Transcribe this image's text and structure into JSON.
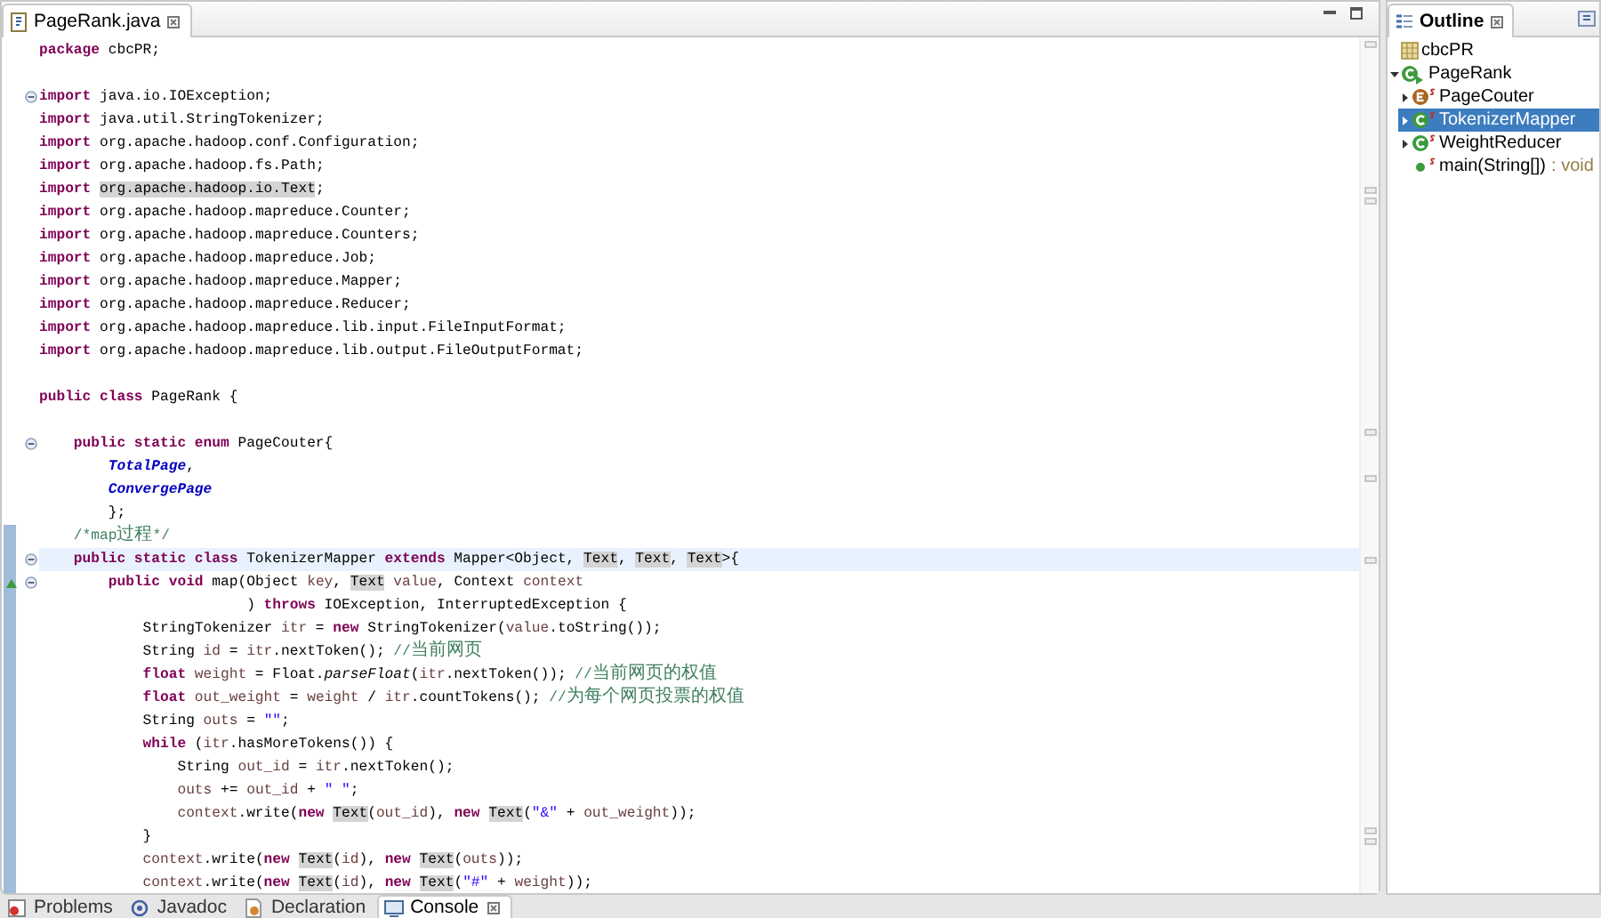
{
  "editor": {
    "tab": {
      "label": "PageRank.java"
    },
    "lines": [
      {
        "current": false,
        "fold": false,
        "range": false,
        "override": false,
        "tokens": [
          {
            "kind": "kw",
            "text": "package"
          },
          {
            "kind": "plain",
            "text": " cbcPR;"
          }
        ]
      },
      {
        "current": false,
        "fold": false,
        "range": false,
        "override": false
      },
      {
        "current": false,
        "fold": true,
        "range": false,
        "override": false,
        "tokens": [
          {
            "kind": "kw",
            "text": "import"
          },
          {
            "kind": "plain",
            "text": " java.io.IOException;"
          }
        ]
      },
      {
        "current": false,
        "fold": false,
        "range": false,
        "override": false,
        "tokens": [
          {
            "kind": "kw",
            "text": "import"
          },
          {
            "kind": "plain",
            "text": " java.util.StringTokenizer;"
          }
        ]
      },
      {
        "current": false,
        "fold": false,
        "range": false,
        "override": false,
        "tokens": [
          {
            "kind": "kw",
            "text": "import"
          },
          {
            "kind": "plain",
            "text": " org.apache.hadoop.conf.Configuration;"
          }
        ]
      },
      {
        "current": false,
        "fold": false,
        "range": false,
        "override": false,
        "tokens": [
          {
            "kind": "kw",
            "text": "import"
          },
          {
            "kind": "plain",
            "text": " org.apache.hadoop.fs.Path;"
          }
        ]
      },
      {
        "current": false,
        "fold": false,
        "range": false,
        "override": false,
        "tokens": [
          {
            "kind": "kw",
            "text": "import "
          },
          {
            "kind": "mark",
            "text": "org.apache.hadoop.io.Text"
          },
          {
            "kind": "plain",
            "text": ";"
          }
        ]
      },
      {
        "current": false,
        "fold": false,
        "range": false,
        "override": false,
        "tokens": [
          {
            "kind": "kw",
            "text": "import"
          },
          {
            "kind": "plain",
            "text": " org.apache.hadoop.mapreduce.Counter;"
          }
        ]
      },
      {
        "current": false,
        "fold": false,
        "range": false,
        "override": false,
        "tokens": [
          {
            "kind": "kw",
            "text": "import"
          },
          {
            "kind": "plain",
            "text": " org.apache.hadoop.mapreduce.Counters;"
          }
        ]
      },
      {
        "current": false,
        "fold": false,
        "range": false,
        "override": false,
        "tokens": [
          {
            "kind": "kw",
            "text": "import"
          },
          {
            "kind": "plain",
            "text": " org.apache.hadoop.mapreduce.Job;"
          }
        ]
      },
      {
        "current": false,
        "fold": false,
        "range": false,
        "override": false,
        "tokens": [
          {
            "kind": "kw",
            "text": "import"
          },
          {
            "kind": "plain",
            "text": " org.apache.hadoop.mapreduce.Mapper;"
          }
        ]
      },
      {
        "current": false,
        "fold": false,
        "range": false,
        "override": false,
        "tokens": [
          {
            "kind": "kw",
            "text": "import"
          },
          {
            "kind": "plain",
            "text": " org.apache.hadoop.mapreduce.Reducer;"
          }
        ]
      },
      {
        "current": false,
        "fold": false,
        "range": false,
        "override": false,
        "tokens": [
          {
            "kind": "kw",
            "text": "import"
          },
          {
            "kind": "plain",
            "text": " org.apache.hadoop.mapreduce.lib.input.FileInputFormat;"
          }
        ]
      },
      {
        "current": false,
        "fold": false,
        "range": false,
        "override": false,
        "tokens": [
          {
            "kind": "kw",
            "text": "import"
          },
          {
            "kind": "plain",
            "text": " org.apache.hadoop.mapreduce.lib.output.FileOutputFormat;"
          }
        ]
      },
      {
        "current": false,
        "fold": false,
        "range": false,
        "override": false
      },
      {
        "current": false,
        "fold": false,
        "range": false,
        "override": false,
        "tokens": [
          {
            "kind": "kw",
            "text": "public class"
          },
          {
            "kind": "plain",
            "text": " PageRank {"
          }
        ]
      },
      {
        "current": false,
        "fold": false,
        "range": false,
        "override": false
      },
      {
        "current": false,
        "fold": true,
        "range": false,
        "override": false,
        "tokens": [
          {
            "kind": "kw",
            "text": "    public static enum"
          },
          {
            "kind": "plain",
            "text": " PageCouter{"
          }
        ]
      },
      {
        "current": false,
        "fold": false,
        "range": false,
        "override": false,
        "tokens": [
          {
            "kind": "const",
            "text": "        TotalPage"
          },
          {
            "kind": "plain",
            "text": ","
          }
        ]
      },
      {
        "current": false,
        "fold": false,
        "range": false,
        "override": false,
        "tokens": [
          {
            "kind": "const",
            "text": "        ConvergePage"
          }
        ]
      },
      {
        "current": false,
        "fold": false,
        "range": false,
        "override": false,
        "tokens": [
          {
            "kind": "plain",
            "text": "        };"
          }
        ]
      },
      {
        "current": false,
        "fold": false,
        "range": true,
        "override": false,
        "tokens": [
          {
            "kind": "comment",
            "text": "    /*map过程*/"
          }
        ]
      },
      {
        "current": true,
        "fold": true,
        "range": true,
        "override": false,
        "tokens": [
          {
            "kind": "kw",
            "text": "    public static class"
          },
          {
            "kind": "plain",
            "text": " TokenizerMapper "
          },
          {
            "kind": "kw",
            "text": "extends"
          },
          {
            "kind": "plain",
            "text": " Mapper<Object, "
          },
          {
            "kind": "mark",
            "text": "Text"
          },
          {
            "kind": "plain",
            "text": ", "
          },
          {
            "kind": "mark",
            "text": "Text"
          },
          {
            "kind": "plain",
            "text": ", "
          },
          {
            "kind": "mark",
            "text": "Text"
          },
          {
            "kind": "plain",
            "text": ">{"
          }
        ]
      },
      {
        "current": false,
        "fold": true,
        "range": true,
        "override": true,
        "tokens": [
          {
            "kind": "kw",
            "text": "        public void"
          },
          {
            "kind": "plain",
            "text": " map(Object "
          },
          {
            "kind": "var",
            "text": "key"
          },
          {
            "kind": "plain",
            "text": ", "
          },
          {
            "kind": "mark",
            "text": "Text"
          },
          {
            "kind": "var",
            "text": " value"
          },
          {
            "kind": "plain",
            "text": ", Context "
          },
          {
            "kind": "var",
            "text": "context"
          }
        ]
      },
      {
        "current": false,
        "fold": false,
        "range": true,
        "override": false,
        "tokens": [
          {
            "kind": "plain",
            "text": "                        ) "
          },
          {
            "kind": "kw",
            "text": "throws"
          },
          {
            "kind": "plain",
            "text": " IOException, InterruptedException {"
          }
        ]
      },
      {
        "current": false,
        "fold": false,
        "range": true,
        "override": false,
        "tokens": [
          {
            "kind": "plain",
            "text": "            StringTokenizer "
          },
          {
            "kind": "var",
            "text": "itr"
          },
          {
            "kind": "plain",
            "text": " = "
          },
          {
            "kind": "kw",
            "text": "new"
          },
          {
            "kind": "plain",
            "text": " StringTokenizer("
          },
          {
            "kind": "var",
            "text": "value"
          },
          {
            "kind": "plain",
            "text": ".toString());"
          }
        ]
      },
      {
        "current": false,
        "fold": false,
        "range": true,
        "override": false,
        "tokens": [
          {
            "kind": "plain",
            "text": "            String "
          },
          {
            "kind": "var",
            "text": "id"
          },
          {
            "kind": "plain",
            "text": " = "
          },
          {
            "kind": "var",
            "text": "itr"
          },
          {
            "kind": "plain",
            "text": ".nextToken(); "
          },
          {
            "kind": "comment",
            "text": "//当前网页"
          }
        ]
      },
      {
        "current": false,
        "fold": false,
        "range": true,
        "override": false,
        "tokens": [
          {
            "kind": "kw",
            "text": "            float"
          },
          {
            "kind": "var",
            "text": " weight"
          },
          {
            "kind": "plain",
            "text": " = Float."
          },
          {
            "kind": "static",
            "text": "parseFloat"
          },
          {
            "kind": "plain",
            "text": "("
          },
          {
            "kind": "var",
            "text": "itr"
          },
          {
            "kind": "plain",
            "text": ".nextToken()); "
          },
          {
            "kind": "comment",
            "text": "//当前网页的权值"
          }
        ]
      },
      {
        "current": false,
        "fold": false,
        "range": true,
        "override": false,
        "tokens": [
          {
            "kind": "kw",
            "text": "            float"
          },
          {
            "kind": "var",
            "text": " out_weight"
          },
          {
            "kind": "plain",
            "text": " = "
          },
          {
            "kind": "var",
            "text": "weight"
          },
          {
            "kind": "plain",
            "text": " / "
          },
          {
            "kind": "var",
            "text": "itr"
          },
          {
            "kind": "plain",
            "text": ".countTokens(); "
          },
          {
            "kind": "comment",
            "text": "//为每个网页投票的权值"
          }
        ]
      },
      {
        "current": false,
        "fold": false,
        "range": true,
        "override": false,
        "tokens": [
          {
            "kind": "plain",
            "text": "            String "
          },
          {
            "kind": "var",
            "text": "outs"
          },
          {
            "kind": "plain",
            "text": " = "
          },
          {
            "kind": "string",
            "text": "\"\""
          },
          {
            "kind": "plain",
            "text": ";"
          }
        ]
      },
      {
        "current": false,
        "fold": false,
        "range": true,
        "override": false,
        "tokens": [
          {
            "kind": "kw",
            "text": "            while"
          },
          {
            "kind": "plain",
            "text": " ("
          },
          {
            "kind": "var",
            "text": "itr"
          },
          {
            "kind": "plain",
            "text": ".hasMoreTokens()) {"
          }
        ]
      },
      {
        "current": false,
        "fold": false,
        "range": true,
        "override": false,
        "tokens": [
          {
            "kind": "plain",
            "text": "                String "
          },
          {
            "kind": "var",
            "text": "out_id"
          },
          {
            "kind": "plain",
            "text": " = "
          },
          {
            "kind": "var",
            "text": "itr"
          },
          {
            "kind": "plain",
            "text": ".nextToken();"
          }
        ]
      },
      {
        "current": false,
        "fold": false,
        "range": true,
        "override": false,
        "tokens": [
          {
            "kind": "var",
            "text": "                outs"
          },
          {
            "kind": "plain",
            "text": " += "
          },
          {
            "kind": "var",
            "text": "out_id"
          },
          {
            "kind": "plain",
            "text": " + "
          },
          {
            "kind": "string",
            "text": "\" \""
          },
          {
            "kind": "plain",
            "text": ";"
          }
        ]
      },
      {
        "current": false,
        "fold": false,
        "range": true,
        "override": false,
        "tokens": [
          {
            "kind": "var",
            "text": "                context"
          },
          {
            "kind": "plain",
            "text": ".write("
          },
          {
            "kind": "kw",
            "text": "new "
          },
          {
            "kind": "mark",
            "text": "Text"
          },
          {
            "kind": "plain",
            "text": "("
          },
          {
            "kind": "var",
            "text": "out_id"
          },
          {
            "kind": "plain",
            "text": "), "
          },
          {
            "kind": "kw",
            "text": "new "
          },
          {
            "kind": "mark",
            "text": "Text"
          },
          {
            "kind": "plain",
            "text": "("
          },
          {
            "kind": "string",
            "text": "\"&\""
          },
          {
            "kind": "plain",
            "text": " + "
          },
          {
            "kind": "var",
            "text": "out_weight"
          },
          {
            "kind": "plain",
            "text": "));"
          }
        ]
      },
      {
        "current": false,
        "fold": false,
        "range": true,
        "override": false,
        "tokens": [
          {
            "kind": "plain",
            "text": "            }"
          }
        ]
      },
      {
        "current": false,
        "fold": false,
        "range": true,
        "override": false,
        "tokens": [
          {
            "kind": "var",
            "text": "            context"
          },
          {
            "kind": "plain",
            "text": ".write("
          },
          {
            "kind": "kw",
            "text": "new "
          },
          {
            "kind": "mark",
            "text": "Text"
          },
          {
            "kind": "plain",
            "text": "("
          },
          {
            "kind": "var",
            "text": "id"
          },
          {
            "kind": "plain",
            "text": "), "
          },
          {
            "kind": "kw",
            "text": "new "
          },
          {
            "kind": "mark",
            "text": "Text"
          },
          {
            "kind": "plain",
            "text": "("
          },
          {
            "kind": "var",
            "text": "outs"
          },
          {
            "kind": "plain",
            "text": "));"
          }
        ]
      },
      {
        "current": false,
        "fold": false,
        "range": true,
        "override": false,
        "tokens": [
          {
            "kind": "var",
            "text": "            context"
          },
          {
            "kind": "plain",
            "text": ".write("
          },
          {
            "kind": "kw",
            "text": "new "
          },
          {
            "kind": "mark",
            "text": "Text"
          },
          {
            "kind": "plain",
            "text": "("
          },
          {
            "kind": "var",
            "text": "id"
          },
          {
            "kind": "plain",
            "text": "), "
          },
          {
            "kind": "kw",
            "text": "new "
          },
          {
            "kind": "mark",
            "text": "Text"
          },
          {
            "kind": "plain",
            "text": "("
          },
          {
            "kind": "string",
            "text": "\"#\""
          },
          {
            "kind": "plain",
            "text": " + "
          },
          {
            "kind": "var",
            "text": "weight"
          },
          {
            "kind": "plain",
            "text": "));"
          }
        ]
      }
    ]
  },
  "outline": {
    "title": "Outline",
    "items": [
      {
        "kind": "package",
        "label": "cbcPR",
        "selected": false
      },
      {
        "kind": "class",
        "label": "PageRank",
        "selected": false,
        "expanded": true,
        "static": false,
        "runnable": true,
        "children": [
          {
            "kind": "enum",
            "label": "PageCouter",
            "selected": false,
            "expanded": false,
            "static": true
          },
          {
            "kind": "class",
            "label": "TokenizerMapper",
            "selected": true,
            "expanded": false,
            "static": true
          },
          {
            "kind": "class",
            "label": "WeightReducer",
            "selected": false,
            "expanded": false,
            "static": true
          },
          {
            "kind": "method",
            "label": "main(String[])",
            "type": ": void",
            "selected": false,
            "static": true
          }
        ]
      }
    ]
  },
  "bottom_tabs": [
    {
      "kind": "problems",
      "label": "Problems",
      "selected": false
    },
    {
      "kind": "javadoc",
      "label": "Javadoc",
      "selected": false
    },
    {
      "kind": "declaration",
      "label": "Declaration",
      "selected": false
    },
    {
      "kind": "console",
      "label": "Console",
      "selected": true
    }
  ]
}
